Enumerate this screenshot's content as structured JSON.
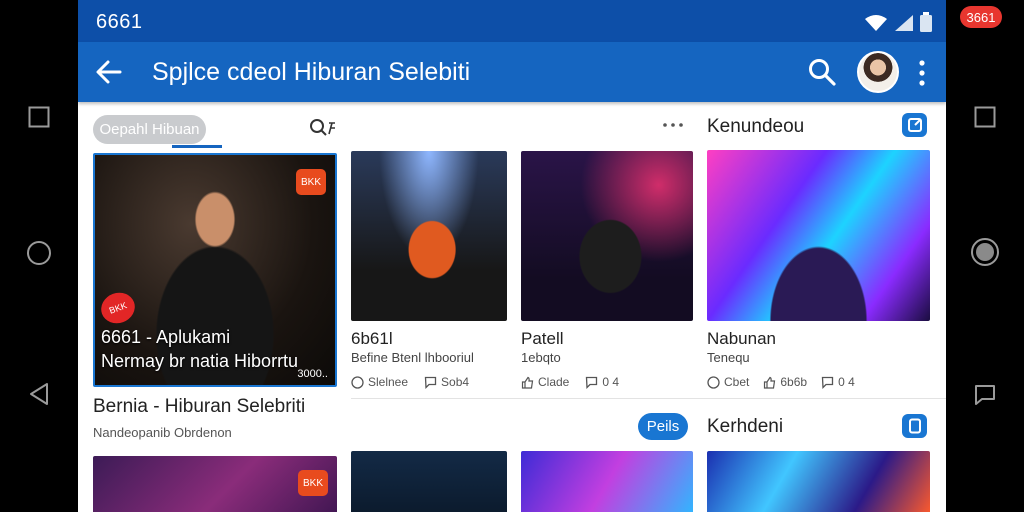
{
  "statusbar": {
    "time": "6661",
    "notification_badge": "3661"
  },
  "appbar": {
    "title": "Spjlce cdeol  Hiburan Selebiti"
  },
  "tabs": {
    "active_label": "Oepahl Hibuan"
  },
  "featured": {
    "badge": "BKK",
    "badge2": "BKK",
    "overlay_line1": "6661 - Aplukami",
    "overlay_line2": "Nermay br natia Hiborrtu",
    "count": "3000..",
    "title": "Bernia - Hiburan Selebriti",
    "subtitle": "Nandeopanib  Obrdenon"
  },
  "cards": [
    {
      "title": "6b61l",
      "subtitle": "Befine Btenl lhbooriul",
      "meta1": "Slelnee",
      "meta2": "Sob4"
    },
    {
      "title": "Patell",
      "subtitle": "1ebqto",
      "meta1": "Clade",
      "meta2": "0 4"
    },
    {
      "title": "Nabunan",
      "subtitle": "Tenequ",
      "meta1": "Cbet",
      "meta2": "6b6b",
      "meta3": "0 4"
    }
  ],
  "sections": {
    "first": {
      "title": "Kenundeou"
    },
    "second": {
      "title": "Kerhdeni",
      "pill_label": "Peils"
    }
  },
  "bottom_row": {
    "badge": "BKK"
  },
  "colors": {
    "appbar": "#1565c0",
    "statusbar": "#0d4fa8",
    "accent": "#1976d2",
    "badge_red": "#e8362f"
  },
  "icons": [
    "square-nav-icon",
    "circle-nav-icon",
    "triangle-nav-icon",
    "back-arrow-icon",
    "search-icon",
    "more-vert-icon",
    "filter-icon",
    "wifi-icon",
    "signal-icon",
    "battery-icon",
    "comment-icon",
    "like-icon",
    "clock-icon"
  ]
}
